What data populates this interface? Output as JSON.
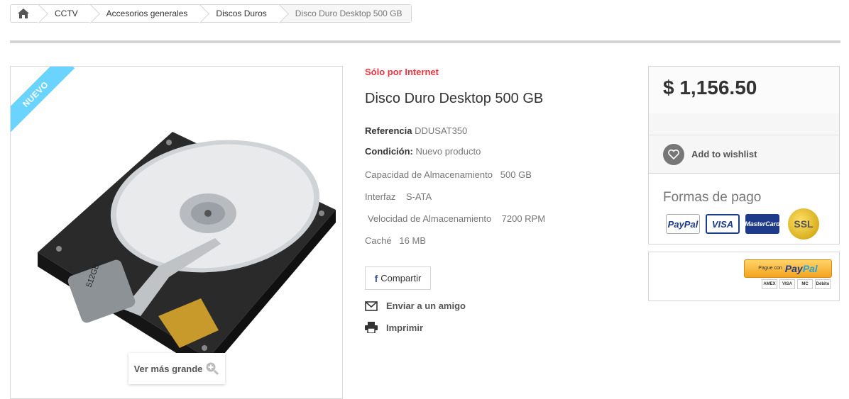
{
  "breadcrumb": {
    "items": [
      "CCTV",
      "Accesorios generales",
      "Discos Duros"
    ],
    "current": "Disco Duro Desktop 500 GB"
  },
  "image": {
    "badge": "NUEVO",
    "hdd_label": "512GB",
    "view_larger": "Ver más grande"
  },
  "product": {
    "online_only": "Sólo por Internet",
    "title": "Disco Duro Desktop 500 GB",
    "reference_label": "Referencia",
    "reference_value": "DDUSAT350",
    "condition_label": "Condición:",
    "condition_value": "Nuevo producto",
    "features": [
      {
        "name": "Capacidad de Almacenamiento",
        "value": "500 GB"
      },
      {
        "name": "Interfaz",
        "value": "S-ATA"
      },
      {
        "name": "Velocidad de Almacenamiento",
        "value": "7200 RPM"
      },
      {
        "name": "Caché",
        "value": "16 MB"
      }
    ],
    "share_label": "Compartir",
    "send_friend": "Enviar a un amigo",
    "print": "Imprimir"
  },
  "sidebar": {
    "price": "$ 1,156.50",
    "wishlist": "Add to wishlist",
    "payment_title": "Formas de pago",
    "cards": [
      "PayPal",
      "VISA",
      "MasterCard",
      "SSL"
    ],
    "paypal_prefix": "Pague con",
    "paypal_logo_a": "Pay",
    "paypal_logo_b": "Pal",
    "mini_cards": [
      "AMEX",
      "VISA",
      "MC",
      "Débito"
    ]
  },
  "colors": {
    "accent_red": "#f13340",
    "ribbon": "#6ad4ff"
  }
}
